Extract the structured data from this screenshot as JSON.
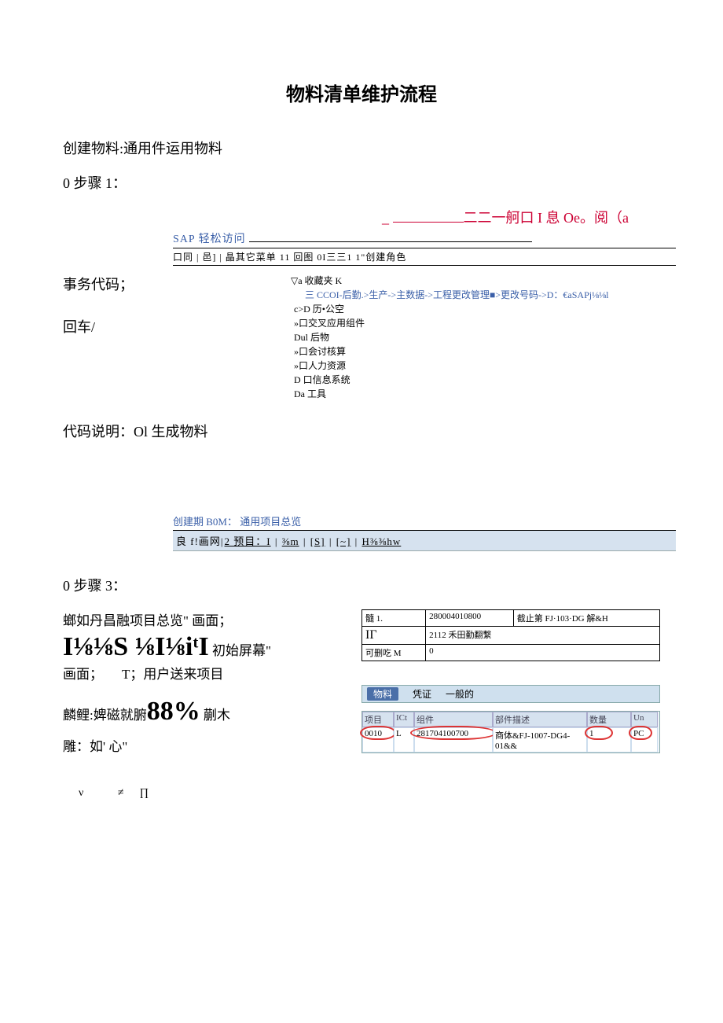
{
  "title": "物料清单维护流程",
  "section1": "创建物料:通用件运用物料",
  "step1_label": "0 步骤 1：",
  "redline": {
    "prefix": "_ ",
    "mid": "二二一舸口 I 息 Oe。阅（a"
  },
  "sap": {
    "title_prefix": "SAP 轻松访问",
    "menubar": "口同 | 邑] | 晶其它菜单 11 回图 0I三三1 1\"创建角色",
    "tree": {
      "fav": "▽a 收藏夹        K",
      "path": "三 CCOI-后勤.>生产->主数据->工程更改管理■>更改号码->D：€aSAPj⅛⅛l",
      "n1": "c>D 历•公空",
      "n2": "»口交叉应用组件",
      "n3": "Dul 后物",
      "n4": "»口会讨核算",
      "n5": "»口人力资源",
      "n6": "D 口信息系统",
      "n7": "Da 工具"
    }
  },
  "left_notes": {
    "a": "事务代码；",
    "b": "回车/"
  },
  "code_desc": "代码说明：Ol 生成物料",
  "bom": {
    "title": "创建期 B0M： 通用项目总览",
    "bar_prefix": "良 f!画网|",
    "bar_seg1": "2 预目：I",
    "bar_seg2": "⅜m",
    "bar_seg3": "[S]",
    "bar_seg4": "[~]",
    "bar_seg5": "H⅜⅜hw"
  },
  "step3_label": "0 步骤 3：",
  "step3_left": {
    "l1": "螂如丹昌融项目总览\" 画面；",
    "big1": "I⅛⅛S ⅛I⅛iᵗI",
    "big1_suffix": " 初始屏幕\"",
    "l2a": "画面；",
    "l2b": "T；用户送来项目",
    "l3a": "麟鲤:婢磁就腑",
    "pct": "88%",
    "l3b": " 蒯木",
    "l4": "雕：如' 心\"",
    "syms": "ν       ≠∏"
  },
  "info": {
    "r1c1": "髓 1.",
    "r1c2": "280004010800",
    "r1c3": "截止第 FJ·103·DG 解&H",
    "r2c1": "IΓ",
    "r2c2": "2112 禾田勤翻繫",
    "r3c1": "可删吃 M",
    "r3c2": "0"
  },
  "tabs": {
    "active": "物料",
    "t2": "凭证",
    "t3": "一般的"
  },
  "grid": {
    "h1": "项目",
    "h2": "ICt",
    "h3": "组件",
    "h4": "部件描述",
    "h5": "数量",
    "h6": "Un",
    "r1": {
      "c1": "0010",
      "c2": "L",
      "c3": "281704100700",
      "c4": "商体&FJ-1007-DG4-01&&",
      "c5": "1",
      "c6": "PC"
    }
  }
}
